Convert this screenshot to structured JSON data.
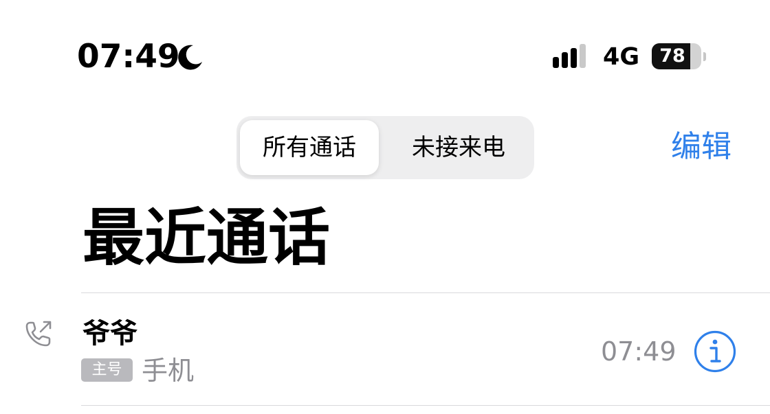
{
  "status_bar": {
    "time": "07:49",
    "network": "4G",
    "battery_level": "78",
    "battery_fraction": 0.78
  },
  "header": {
    "tabs": [
      {
        "label": "所有通话",
        "selected": true
      },
      {
        "label": "未接来电",
        "selected": false
      }
    ],
    "edit_label": "编辑",
    "title": "最近通话"
  },
  "calls": [
    {
      "contact": "爷爷",
      "line_tag": "主号",
      "phone_type": "手机",
      "time": "07:49",
      "icon": "outgoing-call-icon"
    }
  ],
  "colors": {
    "accent": "#2f80ea",
    "secondary_text": "#8e8e93",
    "tag_background": "#b9b9bd"
  }
}
